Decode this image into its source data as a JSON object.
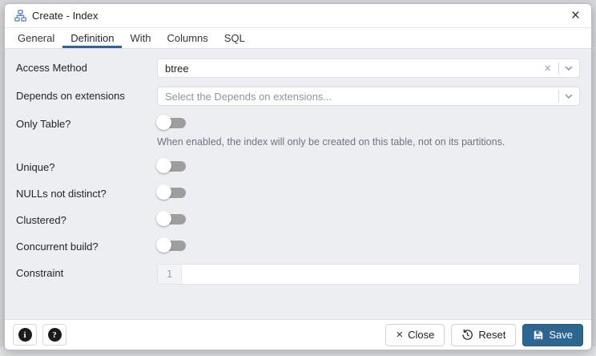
{
  "window": {
    "title": "Create - Index",
    "close_icon": "×"
  },
  "tabs": [
    {
      "label": "General",
      "active": false
    },
    {
      "label": "Definition",
      "active": true
    },
    {
      "label": "With",
      "active": false
    },
    {
      "label": "Columns",
      "active": false
    },
    {
      "label": "SQL",
      "active": false
    }
  ],
  "form": {
    "access_method": {
      "label": "Access Method",
      "value": "btree",
      "clear_icon": "×"
    },
    "depends": {
      "label": "Depends on extensions",
      "placeholder_text": "Select the Depends on extensions..."
    },
    "only_table": {
      "label": "Only Table?",
      "state": "off",
      "helper": "When enabled, the index will only be created on this table, not on its partitions."
    },
    "unique": {
      "label": "Unique?",
      "state": "off"
    },
    "nulls_not_distinct": {
      "label": "NULLs not distinct?",
      "state": "off"
    },
    "clustered": {
      "label": "Clustered?",
      "state": "off"
    },
    "concurrent_build": {
      "label": "Concurrent build?",
      "state": "off"
    },
    "constraint": {
      "label": "Constraint",
      "line_number": "1",
      "value": ""
    }
  },
  "footer": {
    "info_glyph": "i",
    "help_glyph": "?",
    "close_label": "Close",
    "close_icon": "×",
    "reset_label": "Reset",
    "save_label": "Save"
  },
  "colors": {
    "accent_blue": "#2c6690",
    "toggle_track_off": "#9e9e9e",
    "body_background": "#eceef2",
    "title_icon_blue": "#5b84c4"
  }
}
